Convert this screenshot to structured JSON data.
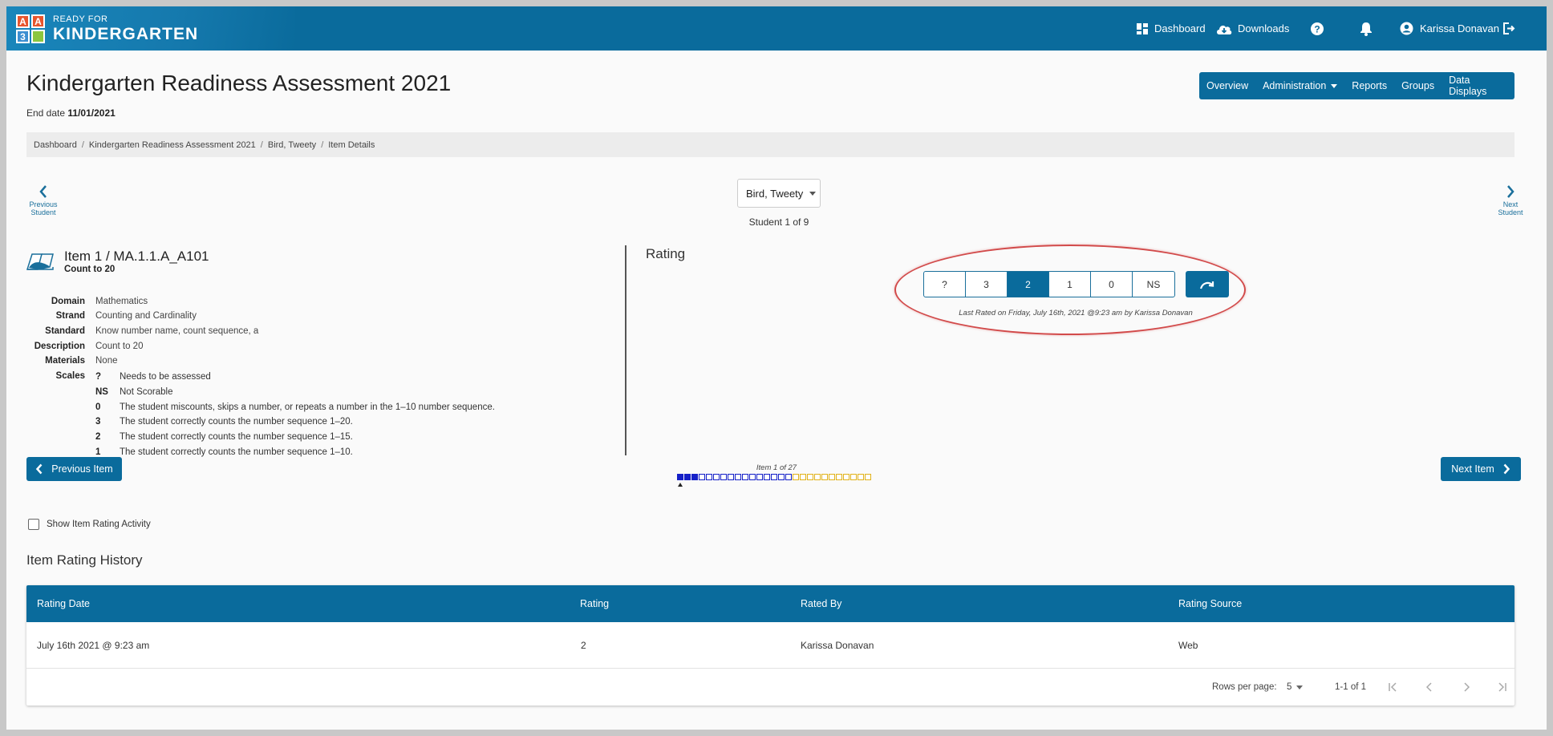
{
  "app": {
    "logo_letters": [
      "A",
      "A",
      "3",
      ""
    ],
    "logo_small": "READY FOR",
    "logo_big": "KINDERGARTEN",
    "colors": {
      "primary": "#0a6b9c",
      "progress_done": "#1520c8",
      "progress_future": "#e1b21a",
      "highlight_oval": "#d24a4a"
    }
  },
  "topnav": {
    "dashboard": "Dashboard",
    "downloads": "Downloads",
    "help_icon": "question-circle-icon",
    "notifications_icon": "bell-icon",
    "user": "Karissa Donavan",
    "logout_icon": "logout-icon"
  },
  "header": {
    "title": "Kindergarten Readiness Assessment 2021",
    "end_date_label": "End date",
    "end_date": "11/01/2021",
    "nav": [
      "Overview",
      "Administration",
      "Reports",
      "Groups",
      "Data Displays"
    ]
  },
  "breadcrumb": [
    "Dashboard",
    "Kindergarten Readiness Assessment 2021",
    "Bird, Tweety",
    "Item Details"
  ],
  "student_nav": {
    "prev_label_1": "Previous",
    "prev_label_2": "Student",
    "next_label_1": "Next",
    "next_label_2": "Student",
    "selected_student": "Bird, Tweety",
    "student_count": "Student 1 of 9"
  },
  "item": {
    "title": "Item 1 / MA.1.1.A_A101",
    "subtitle": "Count to 20",
    "fields": [
      {
        "key": "Domain",
        "value": "Mathematics"
      },
      {
        "key": "Strand",
        "value": "Counting and Cardinality"
      },
      {
        "key": "Standard",
        "value": "Know number name, count sequence, a"
      },
      {
        "key": "Description",
        "value": "Count to 20"
      },
      {
        "key": "Materials",
        "value": "None"
      }
    ],
    "scales_label": "Scales",
    "scales": [
      {
        "code": "?",
        "text": "Needs to be assessed"
      },
      {
        "code": "NS",
        "text": "Not Scorable"
      },
      {
        "code": "0",
        "text": "The student miscounts, skips a number, or repeats a number in the 1–10 number sequence."
      },
      {
        "code": "3",
        "text": "The student correctly counts the number sequence 1–20."
      },
      {
        "code": "2",
        "text": "The student correctly counts the number sequence 1–15."
      },
      {
        "code": "1",
        "text": "The student correctly counts the number sequence 1–10."
      }
    ]
  },
  "rating": {
    "title": "Rating",
    "options": [
      "?",
      "3",
      "2",
      "1",
      "0",
      "NS"
    ],
    "selected": "2",
    "redo_icon": "redo-arrow-icon",
    "last_rated": "Last Rated on Friday, July 16th, 2021 @9:23 am by Karissa Donavan"
  },
  "item_nav": {
    "previous": "Previous Item",
    "next": "Next Item",
    "item_count": "Item 1 of 27",
    "progress_total": 27,
    "progress_done": 3,
    "progress_blue_outline": 16
  },
  "activity_checkbox": "Show Item Rating Activity",
  "history": {
    "title": "Item Rating History",
    "columns": [
      "Rating Date",
      "Rating",
      "Rated By",
      "Rating Source"
    ],
    "rows": [
      [
        "July 16th 2021 @ 9:23 am",
        "2",
        "Karissa Donavan",
        "Web"
      ]
    ],
    "rows_per_page_label": "Rows per page:",
    "rows_per_page": "5",
    "page_range": "1-1 of 1"
  }
}
